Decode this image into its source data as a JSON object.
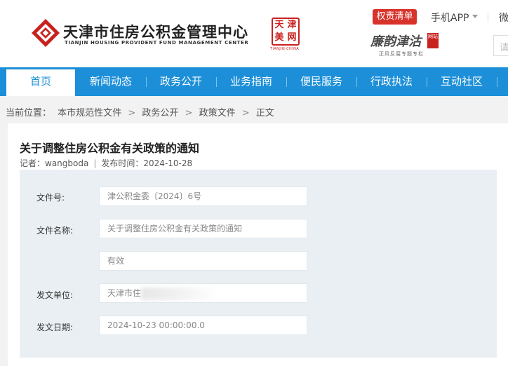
{
  "header": {
    "logo_title": "天津市住房公积金管理中心",
    "logo_subtitle": "TIANJIN HOUSING PROVIDENT FUND MANAGEMENT CENTER",
    "seal_chars": [
      "天",
      "津",
      "美",
      "网"
    ],
    "seal_caption": "TIANJIN·CHINA",
    "badge_label": "权责清单",
    "app_label": "手机APP",
    "weixin_label": "微",
    "lianjie_title": "廉韵津沽",
    "lianjie_tag": "网站",
    "lianjie_subtitle": "正风反腐专题专栏",
    "search_placeholder": "请",
    "colors": {
      "brand_red": "#c9211e",
      "badge_red": "#d8332a"
    }
  },
  "nav": {
    "items": [
      "首页",
      "新闻动态",
      "政务公开",
      "业务指南",
      "便民服务",
      "行政执法",
      "互动社区"
    ],
    "active_index": 0,
    "color": "#1c8fd8"
  },
  "breadcrumb": {
    "prefix": "当前位置：",
    "items": [
      "本市规范性文件",
      "政务公开",
      "政策文件",
      "正文"
    ],
    "separator": ">"
  },
  "article": {
    "title": "关于调整住房公积金有关政策的通知",
    "author_label": "记者：",
    "author": "wangboda",
    "date_label": "发布时间：",
    "date": "2024-10-28"
  },
  "fields": [
    {
      "label": "文件号:",
      "value": "津公积金委〔2024〕6号"
    },
    {
      "label": "文件名称:",
      "value": "关于调整住房公积金有关政策的通知"
    },
    {
      "label": "",
      "value": "有效"
    },
    {
      "label": "发文单位:",
      "value": "天津市住"
    },
    {
      "label": "发文日期:",
      "value": "2024-10-23 00:00:00.0"
    }
  ]
}
